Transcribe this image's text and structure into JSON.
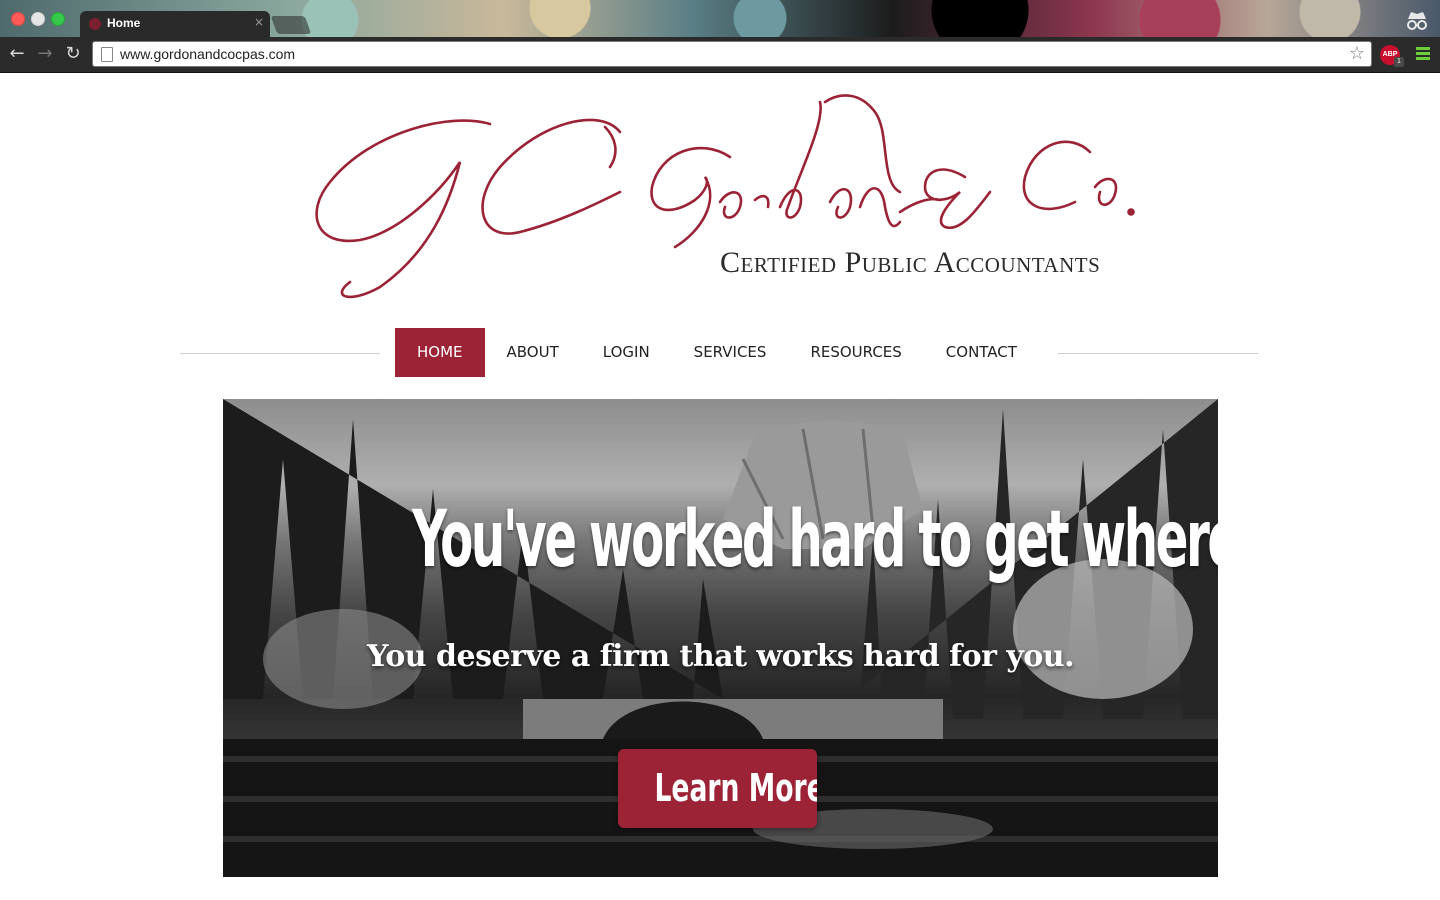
{
  "browser": {
    "tab_title": "Home",
    "tab_close": "×",
    "url": "www.gordonandcocpas.com",
    "back": "←",
    "forward": "→",
    "reload": "↻",
    "star": "☆",
    "abp_label": "ABP",
    "abp_badge": "1"
  },
  "logo": {
    "monogram": "GC",
    "name": "Gordon & Co.",
    "tagline": "Certified Public Accountants",
    "color": "#9b2335"
  },
  "nav": {
    "items": [
      {
        "label": "HOME",
        "active": true
      },
      {
        "label": "ABOUT",
        "active": false
      },
      {
        "label": "LOGIN",
        "active": false
      },
      {
        "label": "SERVICES",
        "active": false
      },
      {
        "label": "RESOURCES",
        "active": false
      },
      {
        "label": "CONTACT",
        "active": false
      }
    ],
    "active_color": "#9b2335"
  },
  "hero": {
    "headline": "You've worked hard to get where you are.",
    "subheadline": "You deserve a firm that works hard for you.",
    "cta_label": "Learn More",
    "cta_color": "#9b2335"
  }
}
